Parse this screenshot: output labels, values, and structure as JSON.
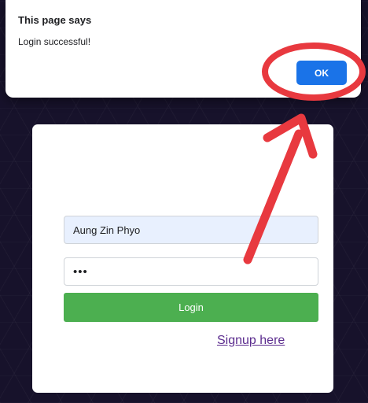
{
  "alert": {
    "title": "This page says",
    "message": "Login successful!",
    "ok_label": "OK"
  },
  "login_form": {
    "username_value": "Aung Zin Phyo",
    "password_value": "•••",
    "login_label": "Login",
    "signup_label": "Signup here"
  },
  "colors": {
    "ok_button": "#1a73e8",
    "login_button": "#4caf50",
    "signup_link": "#5b2c8e",
    "annotation": "#e8393f",
    "background": "#17122b"
  },
  "annotation": {
    "circle_target": "ok-button",
    "arrow_from": "password-field",
    "arrow_to": "ok-button"
  }
}
